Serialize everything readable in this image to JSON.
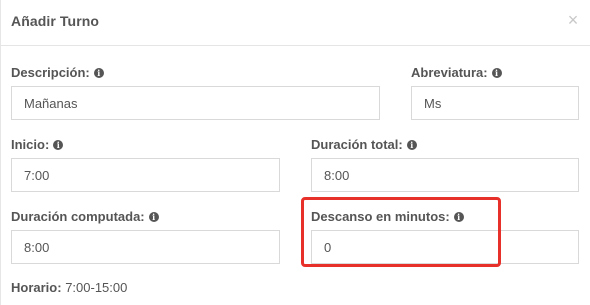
{
  "modal": {
    "title": "Añadir Turno",
    "close_glyph": "×"
  },
  "icons": {
    "info": "info-icon",
    "close": "close-icon"
  },
  "colors": {
    "highlight": "#e8302a"
  },
  "fields": {
    "descripcion": {
      "label": "Descripción:",
      "value": "Mañanas"
    },
    "abreviatura": {
      "label": "Abreviatura:",
      "value": "Ms"
    },
    "inicio": {
      "label": "Inicio:",
      "value": "7:00"
    },
    "duracion_total": {
      "label": "Duración total:",
      "value": "8:00"
    },
    "duracion_computada": {
      "label": "Duración computada:",
      "value": "8:00"
    },
    "descanso": {
      "label": "Descanso en minutos:",
      "value": "0"
    }
  },
  "horario": {
    "label": "Horario:",
    "value": "7:00-15:00"
  }
}
